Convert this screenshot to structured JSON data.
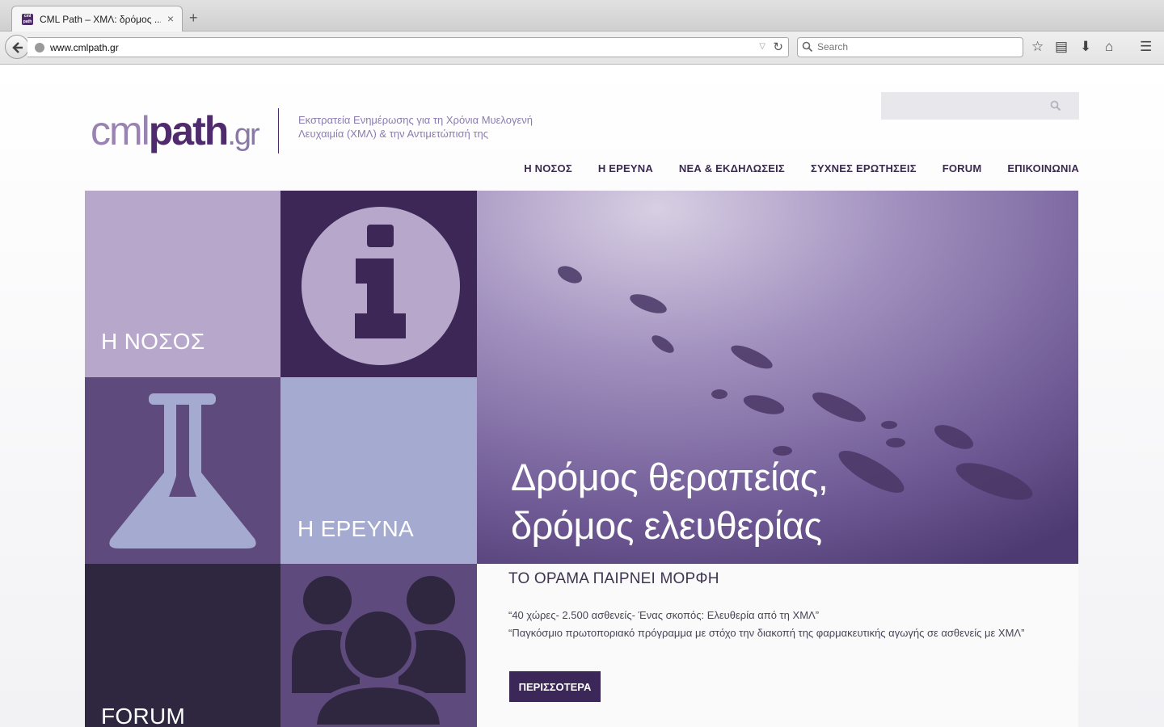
{
  "browser": {
    "tab_title": "CML Path – ΧΜΛ: δρόμος ...",
    "favicon_text": "cml path",
    "url": "www.cmlpath.gr",
    "search_placeholder": "Search"
  },
  "site": {
    "logo": {
      "part1": "cml",
      "part2": "path",
      "part3": ".gr"
    },
    "tagline_line1": "Εκστρατεία Ενημέρωσης για τη Χρόνια Μυελογενή",
    "tagline_line2": "Λευχαιμία (ΧΜΛ) & την Αντιμετώπισή της",
    "nav": [
      "Η ΝΟΣΟΣ",
      "Η ΕΡΕΥΝΑ",
      "ΝΕΑ & ΕΚΔΗΛΩΣΕΙΣ",
      "ΣΥΧΝΕΣ ΕΡΩΤΗΣΕΙΣ",
      "FORUM",
      "ΕΠΙΚΟΙΝΩΝΙΑ"
    ]
  },
  "tiles": {
    "disease_label": "Η ΝΟΣΟΣ",
    "research_label": "Η ΕΡΕΥΝΑ",
    "forum_label": "FORUM"
  },
  "hero": {
    "line1": "Δρόμος θεραπείας,",
    "line2": "δρόμος ελευθερίας"
  },
  "news": {
    "title": "ΤΟ ΟΡΑΜΑ ΠΑΙΡΝΕΙ ΜΟΡΦΗ",
    "quote1": "“40 χώρες- 2.500 ασθενείς- Ένας σκοπός: Ελευθερία από τη ΧΜΛ”",
    "quote2": "“Παγκόσμιο πρωτοποριακό πρόγραμμα με στόχο την διακοπή της φαρμακευτικής αγωγής σε ασθενείς με ΧΜΛ”",
    "button": "ΠΕΡΙΣΣΟΤΕΡΑ"
  },
  "colors": {
    "tile_lavender": "#b7a7cb",
    "tile_deep_purple": "#3d2757",
    "tile_mid_purple": "#5f4a7e",
    "tile_periwinkle": "#a4aad0",
    "tile_dark": "#2f263f",
    "hero_purple": "#6f5a95"
  }
}
